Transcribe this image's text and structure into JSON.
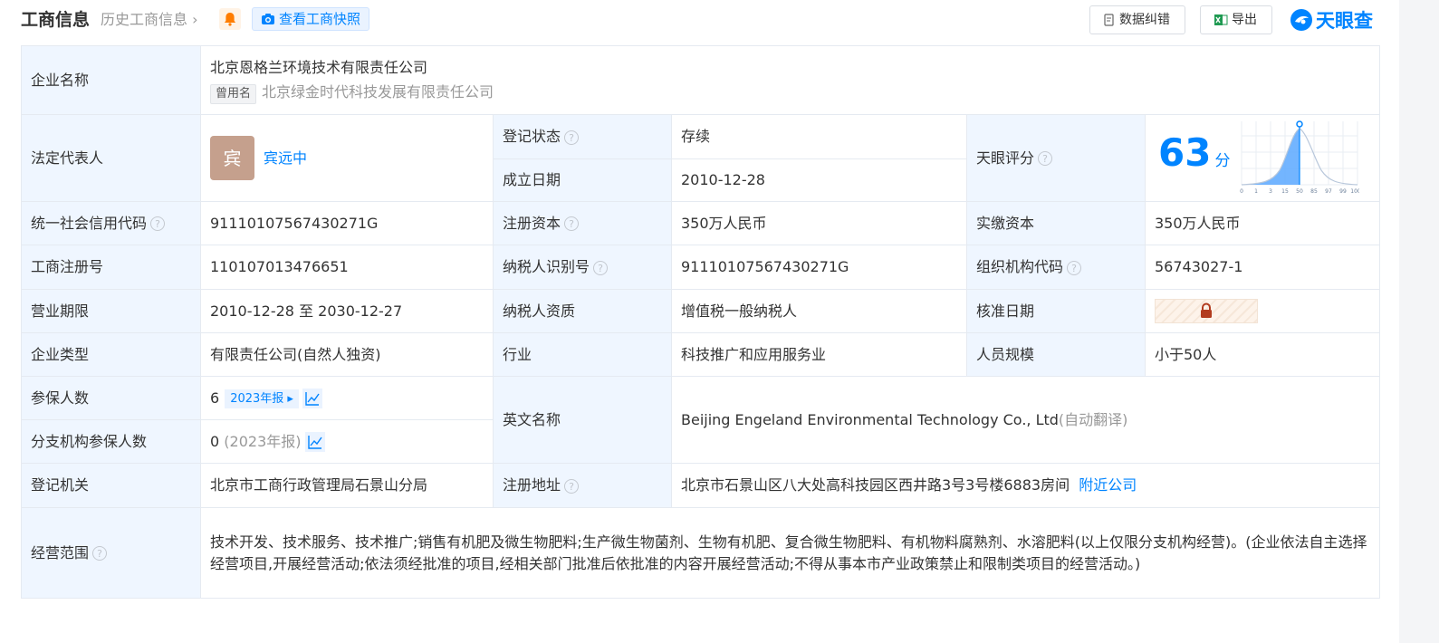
{
  "header": {
    "title": "工商信息",
    "history_link": "历史工商信息",
    "snapshot_button": "查看工商快照",
    "correction_button": "数据纠错",
    "export_button": "导出",
    "logo_text": "天眼查",
    "brand_color": "#0084ff"
  },
  "company": {
    "name_label": "企业名称",
    "name": "北京恩格兰环境技术有限责任公司",
    "former_name_tag": "曾用名",
    "former_name": "北京绿金时代科技发展有限责任公司",
    "legal_rep_label": "法定代表人",
    "legal_rep_avatar": "宾",
    "legal_rep": "宾远中",
    "reg_status_label": "登记状态",
    "reg_status": "存续",
    "founded_label": "成立日期",
    "founded": "2010-12-28",
    "tianyan_score_label": "天眼评分",
    "score": "63",
    "score_unit": "分",
    "score_axis_ticks": [
      "0",
      "1",
      "3",
      "15",
      "50",
      "85",
      "97",
      "99",
      "100"
    ],
    "credit_code_label": "统一社会信用代码",
    "credit_code": "91110107567430271G",
    "reg_capital_label": "注册资本",
    "reg_capital": "350万人民币",
    "paid_capital_label": "实缴资本",
    "paid_capital": "350万人民币",
    "biz_reg_no_label": "工商注册号",
    "biz_reg_no": "110107013476651",
    "taxpayer_id_label": "纳税人识别号",
    "taxpayer_id": "91110107567430271G",
    "org_code_label": "组织机构代码",
    "org_code": "56743027-1",
    "biz_term_label": "营业期限",
    "biz_term": "2010-12-28 至 2030-12-27",
    "taxpayer_qual_label": "纳税人资质",
    "taxpayer_qual": "增值税一般纳税人",
    "approval_date_label": "核准日期",
    "company_type_label": "企业类型",
    "company_type": "有限责任公司(自然人独资)",
    "industry_label": "行业",
    "industry": "科技推广和应用服务业",
    "staff_size_label": "人员规模",
    "staff_size": "小于50人",
    "insured_label": "参保人数",
    "insured_count": "6",
    "insured_report": "2023年报",
    "english_name_label": "英文名称",
    "english_name": "Beijing Engeland Environmental Technology Co., Ltd",
    "english_name_note": "(自动翻译)",
    "branch_insured_label": "分支机构参保人数",
    "branch_insured_count": "0",
    "branch_insured_note": "(2023年报)",
    "reg_authority_label": "登记机关",
    "reg_authority": "北京市工商行政管理局石景山分局",
    "reg_address_label": "注册地址",
    "reg_address": "北京市石景山区八大处高科技园区西井路3号3号楼6883房间",
    "nearby_link": "附近公司",
    "scope_label": "经营范围",
    "scope": "技术开发、技术服务、技术推广;销售有机肥及微生物肥料;生产微生物菌剂、生物有机肥、复合微生物肥料、有机物料腐熟剂、水溶肥料(以上仅限分支机构经营)。(企业依法自主选择经营项目,开展经营活动;依法须经批准的项目,经相关部门批准后依批准的内容开展经营活动;不得从事本市产业政策禁止和限制类项目的经营活动。)"
  }
}
